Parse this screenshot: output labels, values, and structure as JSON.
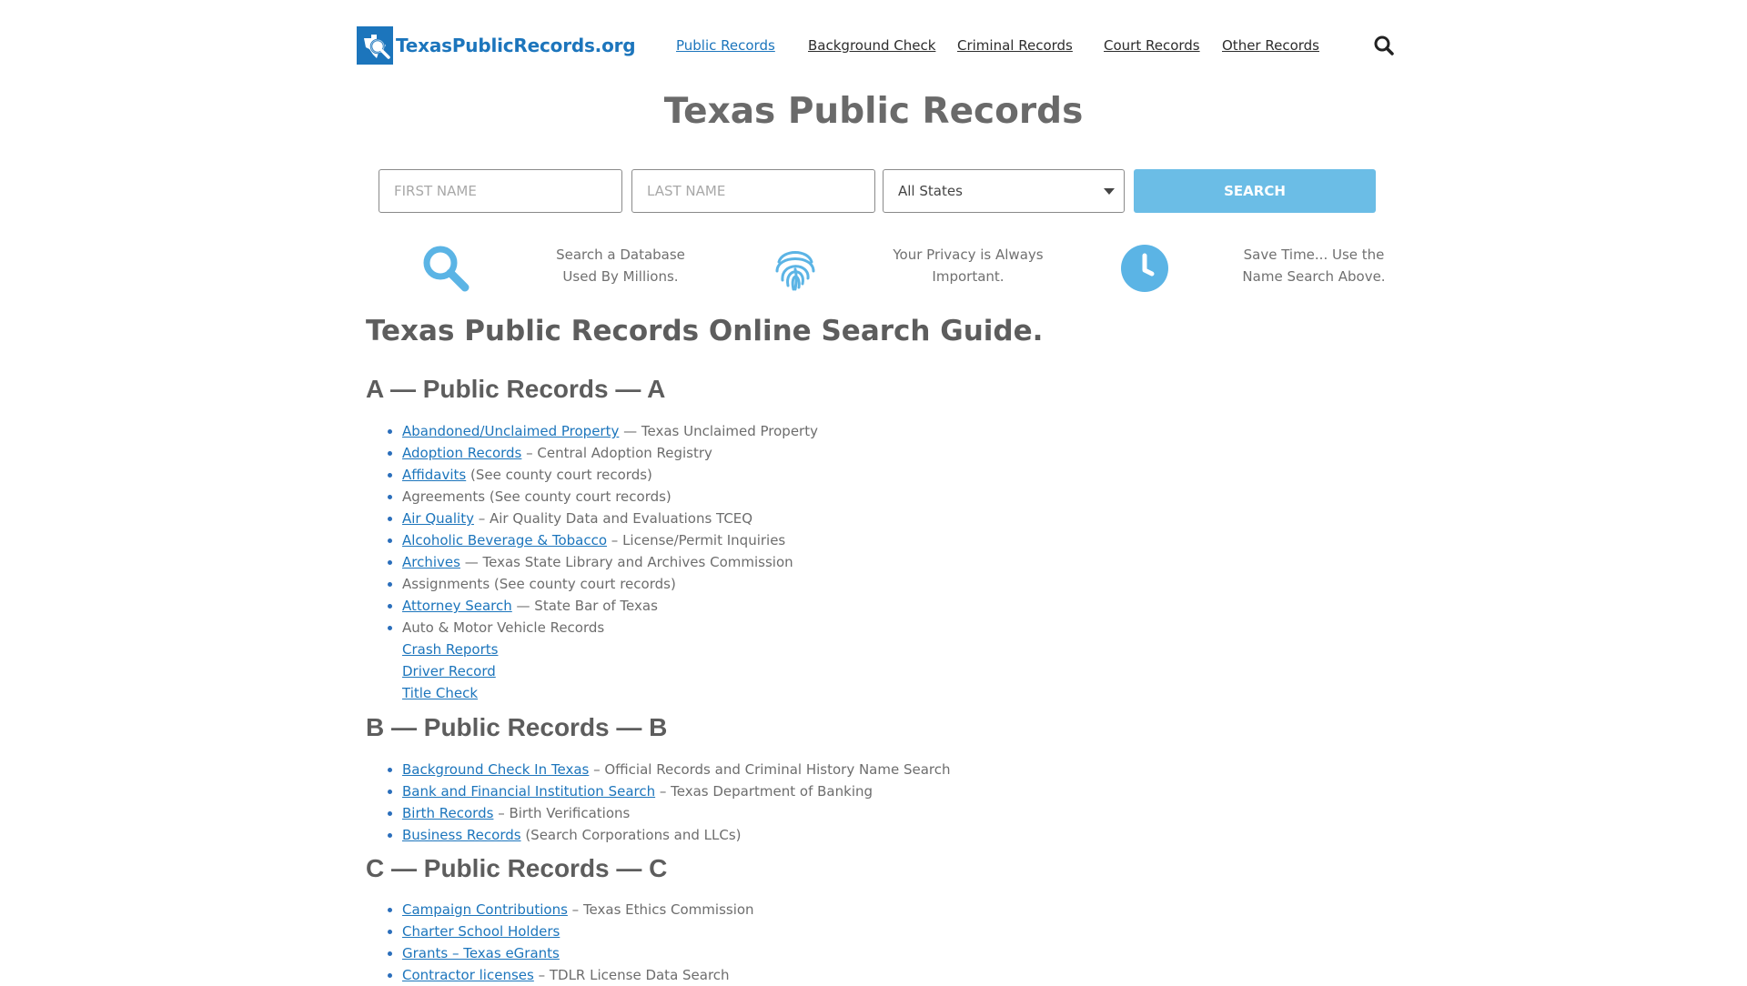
{
  "header": {
    "logo_text": "TexasPublicRecords.org",
    "nav": [
      {
        "label": "Public Records",
        "active": true
      },
      {
        "label": "Background Check",
        "active": false
      },
      {
        "label": "Criminal Records",
        "active": false
      },
      {
        "label": "Court Records",
        "active": false
      },
      {
        "label": "Other Records",
        "active": false
      }
    ],
    "search_icon": "search-icon"
  },
  "hero": {
    "title": "Texas Public Records"
  },
  "search_form": {
    "first_name_placeholder": "FIRST NAME",
    "last_name_placeholder": "LAST NAME",
    "state_selected": "All States",
    "button_label": "SEARCH"
  },
  "features": [
    {
      "icon": "magnifier-icon",
      "line1": "Search a Database",
      "line2": "Used By Millions."
    },
    {
      "icon": "fingerprint-icon",
      "line1": "Your Privacy is Always",
      "line2": "Important."
    },
    {
      "icon": "clock-icon",
      "line1": "Save Time... Use the",
      "line2": "Name Search Above."
    }
  ],
  "guide_title": "Texas Public Records Online Search Guide.",
  "sections": [
    {
      "heading": "A — Public Records — A",
      "items": [
        {
          "link": "Abandoned/Unclaimed Property",
          "rest": " — Texas Unclaimed Property",
          "bullet": true
        },
        {
          "link": "Adoption Records",
          "rest": " – Central Adoption Registry",
          "bullet": true
        },
        {
          "link": "Affidavits",
          "rest": " (See county court records)",
          "bullet": true
        },
        {
          "link": "",
          "rest": "Agreements (See county court records)",
          "bullet": true
        },
        {
          "link": "Air Quality",
          "rest": " – Air Quality Data and Evaluations TCEQ",
          "bullet": true
        },
        {
          "link": "Alcoholic Beverage & Tobacco",
          "rest": " – License/Permit Inquiries",
          "bullet": true
        },
        {
          "link": "Archives",
          "rest": " — Texas State Library and Archives Commission",
          "bullet": true
        },
        {
          "link": "",
          "rest": "Assignments (See county court records)",
          "bullet": true
        },
        {
          "link": "Attorney Search",
          "rest": " — State Bar of Texas",
          "bullet": true
        },
        {
          "link": "",
          "rest": "Auto & Motor Vehicle Records",
          "bullet": true
        },
        {
          "link": "Crash Reports",
          "rest": "",
          "bullet": false
        },
        {
          "link": "Driver Record",
          "rest": "",
          "bullet": false
        },
        {
          "link": "Title Check",
          "rest": "",
          "bullet": false
        }
      ]
    },
    {
      "heading": "B — Public Records — B",
      "items": [
        {
          "link": "Background Check In Texas",
          "rest": " –  Official Records and Criminal History Name Search",
          "bullet": true
        },
        {
          "link": "Bank and Financial Institution Search",
          "rest": " – Texas Department of Banking",
          "bullet": true
        },
        {
          "link": "Birth Records",
          "rest": " – Birth Verifications",
          "bullet": true
        },
        {
          "link": "Business Records",
          "rest": " (Search Corporations and LLCs)",
          "bullet": true
        }
      ]
    },
    {
      "heading": "C — Public Records — C",
      "items": [
        {
          "link": "Campaign Contributions",
          "rest": " – Texas Ethics Commission",
          "bullet": true
        },
        {
          "link": "Charter School Holders",
          "rest": "",
          "bullet": true
        },
        {
          "link": "Grants – Texas eGrants",
          "rest": "",
          "bullet": true
        },
        {
          "link": "Contractor licenses",
          "rest": " – TDLR License Data Search",
          "bullet": true
        }
      ]
    }
  ],
  "colors": {
    "brand_blue": "#1c75bc",
    "button_blue": "#6bbde6",
    "icon_blue": "#5bb4e5"
  }
}
